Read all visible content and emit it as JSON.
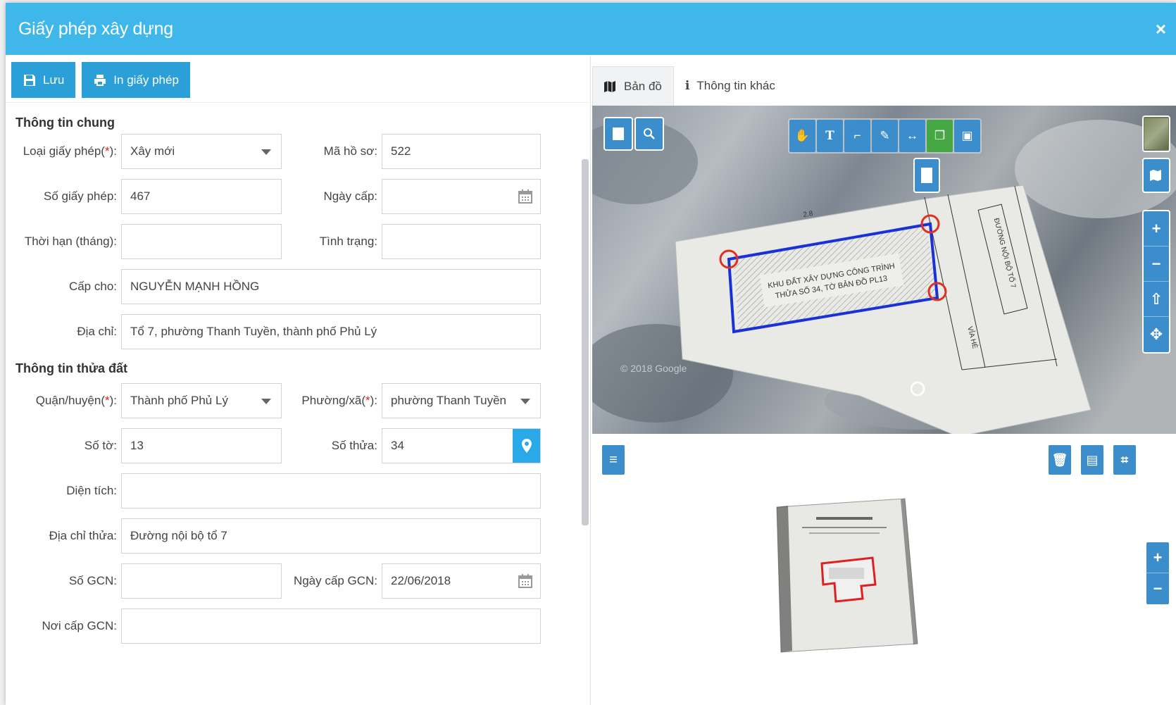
{
  "header": {
    "title": "Giấy phép xây dựng",
    "close_icon": "×"
  },
  "toolbar": {
    "save_label": "Lưu",
    "print_label": "In giấy phép"
  },
  "general": {
    "title": "Thông tin chung",
    "license_type": {
      "label": "Loại giấy phép(",
      "req": "*",
      "tail": "):",
      "value": "Xây mới"
    },
    "file_code": {
      "label": "Mã hồ sơ:",
      "value": "522"
    },
    "license_no": {
      "label": "Số giấy phép:",
      "value": "467"
    },
    "issue_date": {
      "label": "Ngày cấp:",
      "value": ""
    },
    "duration": {
      "label": "Thời hạn (tháng):",
      "value": ""
    },
    "status": {
      "label": "Tình trạng:",
      "value": ""
    },
    "issued_to": {
      "label": "Cấp cho:",
      "value": "NGUYỄN MẠNH HỒNG"
    },
    "address": {
      "label": "Địa chỉ:",
      "value": "Tổ 7, phường Thanh Tuyền, thành phố Phủ Lý"
    }
  },
  "land": {
    "title": "Thông tin thửa đất",
    "district": {
      "label": "Quận/huyện(",
      "req": "*",
      "tail": "):",
      "value": "Thành phố Phủ Lý"
    },
    "ward": {
      "label": "Phường/xã(",
      "req": "*",
      "tail": "):",
      "value": "phường Thanh Tuyền"
    },
    "sheet_no": {
      "label": "Số tờ:",
      "value": "13"
    },
    "parcel_no": {
      "label": "Số thửa:",
      "value": "34"
    },
    "area": {
      "label": "Diện tích:",
      "value": ""
    },
    "parcel_address": {
      "label": "Địa chỉ thửa:",
      "value": "Đường nội bộ tổ 7"
    },
    "gcn_no": {
      "label": "Số GCN:",
      "value": ""
    },
    "gcn_date": {
      "label": "Ngày cấp GCN:",
      "value": "22/06/2018"
    },
    "gcn_place": {
      "label": "Nơi cấp GCN:",
      "value": ""
    }
  },
  "tabs": [
    {
      "label": "Bản đồ",
      "icon": "map-icon"
    },
    {
      "label": "Thông tin khác",
      "icon": "info-icon"
    }
  ],
  "map": {
    "plan_text_1": "KHU ĐẤT XÂY DỰNG CÔNG TRÌNH",
    "plan_text_2": "THỬA SỐ 34, TỜ BẢN ĐỒ PL13",
    "road_label": "ĐƯỜNG NỘI BỘ TỔ 7",
    "sidewalk_label": "VỈA HÈ",
    "watermark": "© 2018 Google",
    "dimension_label": "2.8"
  },
  "colors": {
    "header": "#3fb7ea",
    "button": "#2a9fd8",
    "map_button": "#3b8dcc",
    "active_tool": "#45a845",
    "required": "#e02020"
  }
}
